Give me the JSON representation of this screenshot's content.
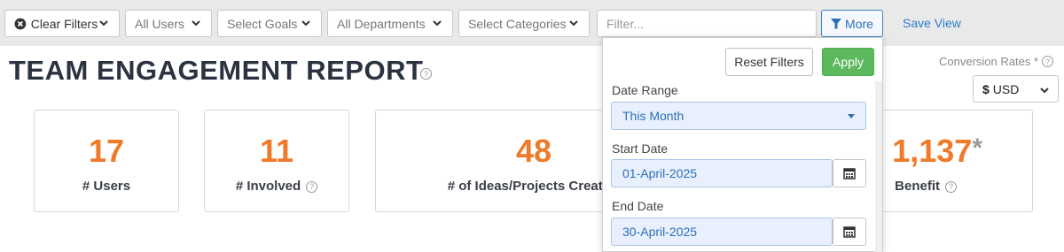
{
  "filters": {
    "clear_filters": "Clear Filters",
    "users": "All Users",
    "goals": "Select Goals",
    "departments": "All Departments",
    "categories": "Select Categories",
    "filter_placeholder": "Filter...",
    "more": "More",
    "save_view": "Save View"
  },
  "report": {
    "title": "TEAM ENGAGEMENT REPORT",
    "conversion_label": "Conversion Rates *",
    "currency": "USD"
  },
  "cards": [
    {
      "value": "17",
      "label": "# Users"
    },
    {
      "value": "11",
      "label": "# Involved"
    },
    {
      "value": "48",
      "label": "# of Ideas/Projects Created"
    },
    {
      "value": "1,137",
      "label": "Benefit",
      "asterisk": "*"
    }
  ],
  "more_panel": {
    "reset": "Reset Filters",
    "apply": "Apply",
    "date_range_label": "Date Range",
    "date_range_value": "This Month",
    "start_label": "Start Date",
    "start_value": "01-April-2025",
    "end_label": "End Date",
    "end_value": "30-April-2025"
  },
  "colors": {
    "accent_orange": "#f07a2a",
    "link_blue": "#2d7bd0",
    "apply_green": "#5cb85c"
  }
}
